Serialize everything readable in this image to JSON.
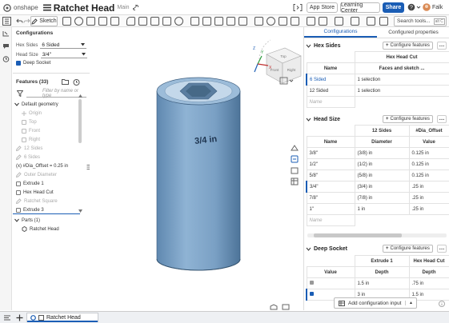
{
  "app": {
    "brand": "onshape",
    "doc_title": "Ratchet Head",
    "branch": "Main"
  },
  "topbar": {
    "app_store": "App Store",
    "learning_center": "Learning Center",
    "share": "Share",
    "help": "?",
    "user": "Falk"
  },
  "toolbar": {
    "sketch_label": "Sketch",
    "search_placeholder": "Search tools...",
    "search_shortcut": "alt C"
  },
  "configurations": {
    "title": "Configurations",
    "hex_sides_label": "Hex Sides",
    "hex_sides_value": "6 Sided",
    "head_size_label": "Head Size",
    "head_size_value": "3/4\"",
    "deep_socket_label": "Deep Socket"
  },
  "features": {
    "title": "Features (33)",
    "filter_placeholder": "Filter by name or type",
    "items": [
      "Default geometry",
      "Origin",
      "Top",
      "Front",
      "Right",
      "12 Sides",
      "6 Sides",
      "(x) #Dia_Offset = 0.25 in",
      "Outer Diameter",
      "Extrude 1",
      "Hex Head Cut",
      "Ratchet Square",
      "Extrude 3",
      "Parts (1)",
      "Ratchet Head"
    ]
  },
  "viewport": {
    "engraving": "3/4 in",
    "cube_top": "Top",
    "cube_front": "Front",
    "cube_right": "Right",
    "axis_x": "X",
    "axis_y": "Y",
    "axis_z": "Z"
  },
  "right_panel": {
    "tabs": [
      "Configurations",
      "Configured properties"
    ],
    "configure_features": "Configure features",
    "hex_sides": {
      "title": "Hex Sides",
      "col_group": "Hex Head Cut",
      "headers": [
        "Name",
        "Faces and sketch ..."
      ],
      "rows": [
        [
          "6 Sided",
          "1 selection"
        ],
        [
          "12 Sided",
          "1 selection"
        ]
      ],
      "name_placeholder": "Name"
    },
    "head_size": {
      "title": "Head Size",
      "col_groups": [
        "12 Sides",
        "#Dia_Offset"
      ],
      "headers": [
        "Name",
        "Diameter",
        "Value"
      ],
      "rows": [
        [
          "3/8\"",
          "(3/8) in",
          "0.125 in"
        ],
        [
          "1/2\"",
          "(1/2) in",
          "0.125 in"
        ],
        [
          "5/8\"",
          "(5/8) in",
          "0.125 in"
        ],
        [
          "3/4\"",
          "(3/4) in",
          ".25 in"
        ],
        [
          "7/8\"",
          "(7/8) in",
          ".25 in"
        ],
        [
          "1\"",
          "1 in",
          ".25 in"
        ]
      ],
      "name_placeholder": "Name"
    },
    "deep_socket": {
      "title": "Deep Socket",
      "col_groups": [
        "Extrude 1",
        "Hex Head Cut"
      ],
      "headers": [
        "Value",
        "Depth",
        "Depth"
      ],
      "rows": [
        [
          "",
          "1.5 in",
          ".75 in"
        ],
        [
          "",
          "3 in",
          "1.5 in"
        ]
      ]
    },
    "add_config_input": "Add configuration input"
  },
  "bottombar": {
    "tab_label": "Ratchet Head"
  },
  "colors": {
    "accent": "#1a5db5",
    "part": "#7aa0c4"
  }
}
